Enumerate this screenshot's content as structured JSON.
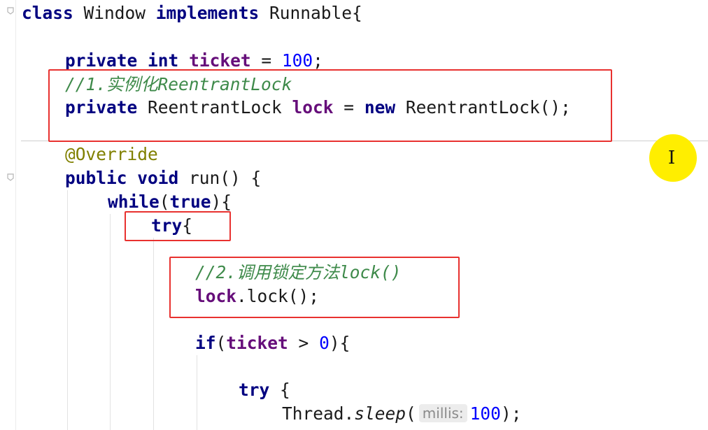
{
  "editor": {
    "lines": [
      {
        "id": "class-decl",
        "parts": [
          [
            "kw",
            "class"
          ],
          [
            "plain",
            " Window "
          ],
          [
            "kw",
            "implements"
          ],
          [
            "plain",
            " Runnable{"
          ]
        ]
      },
      {
        "id": "ticket-field",
        "parts": [
          [
            "kw",
            "private"
          ],
          [
            "plain",
            " "
          ],
          [
            "kw",
            "int"
          ],
          [
            "plain",
            " "
          ],
          [
            "field",
            "ticket"
          ],
          [
            "plain",
            " = "
          ],
          [
            "num",
            "100"
          ],
          [
            "plain",
            ";"
          ]
        ]
      },
      {
        "id": "comment-1",
        "parts": [
          [
            "cmt",
            "//1.实例化ReentrantLock"
          ]
        ]
      },
      {
        "id": "lock-field",
        "parts": [
          [
            "kw",
            "private"
          ],
          [
            "plain",
            " ReentrantLock "
          ],
          [
            "field",
            "lock"
          ],
          [
            "plain",
            " = "
          ],
          [
            "kw",
            "new"
          ],
          [
            "plain",
            " ReentrantLock();"
          ]
        ]
      },
      {
        "id": "override-annotation",
        "parts": [
          [
            "ann",
            "@Override"
          ]
        ]
      },
      {
        "id": "run-method",
        "parts": [
          [
            "kw",
            "public"
          ],
          [
            "plain",
            " "
          ],
          [
            "kw",
            "void"
          ],
          [
            "plain",
            " run() {"
          ]
        ]
      },
      {
        "id": "while-loop",
        "parts": [
          [
            "kw",
            "while"
          ],
          [
            "plain",
            "("
          ],
          [
            "kw",
            "true"
          ],
          [
            "plain",
            "){"
          ]
        ]
      },
      {
        "id": "try-outer",
        "parts": [
          [
            "kw",
            "try"
          ],
          [
            "plain",
            "{"
          ]
        ]
      },
      {
        "id": "comment-2",
        "parts": [
          [
            "cmt",
            "//2.调用锁定方法lock()"
          ]
        ]
      },
      {
        "id": "lock-call",
        "parts": [
          [
            "field",
            "lock"
          ],
          [
            "plain",
            ".lock();"
          ]
        ]
      },
      {
        "id": "if-ticket",
        "parts": [
          [
            "kw",
            "if"
          ],
          [
            "plain",
            "("
          ],
          [
            "field",
            "ticket"
          ],
          [
            "plain",
            " > "
          ],
          [
            "num",
            "0"
          ],
          [
            "plain",
            "){"
          ]
        ]
      },
      {
        "id": "try-inner",
        "parts": [
          [
            "kw",
            "try"
          ],
          [
            "plain",
            " {"
          ]
        ]
      },
      {
        "id": "thread-sleep",
        "parts": [
          [
            "plain",
            "Thread."
          ],
          [
            "call",
            "sleep"
          ],
          [
            "plain",
            "("
          ],
          [
            "hint",
            "millis:"
          ],
          [
            "num",
            "100"
          ],
          [
            "plain",
            ");"
          ]
        ]
      }
    ]
  },
  "colors": {
    "keyword": "#000080",
    "field": "#660e7a",
    "number": "#0000ff",
    "comment": "#3e8a4a",
    "annotation": "#808000",
    "highlight_box": "#e8312f",
    "cursor_highlight": "#ffee00"
  },
  "icons": [
    "fold-marker-icon",
    "text-cursor-icon"
  ]
}
